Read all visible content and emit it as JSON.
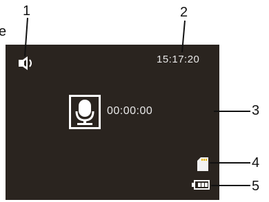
{
  "callouts": {
    "c1": "1",
    "c2": "2",
    "c3": "3",
    "c4": "4",
    "c5": "5"
  },
  "edge_text": "e",
  "screen": {
    "clock": "15:17:20",
    "record_timer": "00:00:00",
    "background_color": "#2a241f",
    "text_color": "#e8e8e8"
  },
  "icons": {
    "speaker": "speaker-icon",
    "microphone": "microphone-icon",
    "sd_card": "sd-card-icon",
    "battery": "battery-icon"
  }
}
